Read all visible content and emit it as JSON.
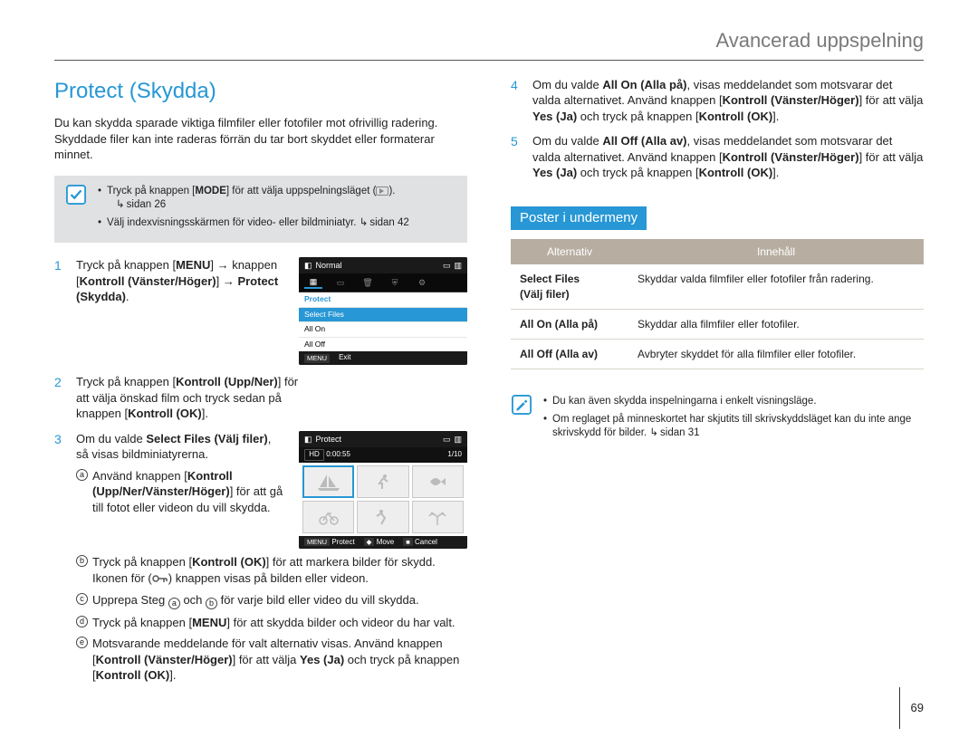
{
  "header": {
    "title": "Avancerad uppspelning"
  },
  "page_number": "69",
  "left": {
    "section_title": "Protect (Skydda)",
    "intro": "Du kan skydda sparade viktiga filmfiler eller fotofiler mot ofrivillig radering. Skyddade filer kan inte raderas förrän du tar bort skyddet eller formaterar minnet.",
    "note": {
      "items": [
        "Tryck på knappen [MODE] för att välja uppspelningsläget (   ).",
        "Välj indexvisningsskärmen för video- eller bildminiatyr."
      ],
      "refs": [
        "sidan 26",
        "sidan 42"
      ]
    },
    "steps": [
      {
        "n": 1,
        "parts": [
          "Tryck på knappen [",
          "MENU",
          "] → knappen [",
          "Kontroll (Vänster/Höger)",
          "] → ",
          "Protect (Skydda)",
          "."
        ]
      },
      {
        "n": 2,
        "parts": [
          "Tryck på knappen [",
          "Kontroll (Upp/Ner)",
          "] för att välja önskad film och tryck sedan på knappen [",
          "Kontroll (OK)",
          "]."
        ]
      },
      {
        "n": 3,
        "lead_parts": [
          "Om du valde ",
          "Select Files (Välj filer)",
          ", så visas bildminiatyrerna."
        ],
        "sub": [
          {
            "m": "a",
            "parts": [
              "Använd knappen [",
              "Kontroll (Upp/Ner/Vänster/Höger)",
              "] för att gå till fotot eller videon du vill skydda."
            ]
          },
          {
            "m": "b",
            "parts": [
              "Tryck på knappen [",
              "Kontroll (OK)",
              "] för att markera bilder för skydd. Ikonen för (   ) knappen visas på bilden eller videon."
            ]
          },
          {
            "m": "c",
            "parts_pre": "Upprepa Steg ",
            "marker1": "a",
            "mid": " och ",
            "marker2": "b",
            "parts_post": " för varje bild eller video du vill skydda."
          },
          {
            "m": "d",
            "parts": [
              "Tryck på knappen [",
              "MENU",
              "] för att skydda bilder och videor du har valt."
            ]
          },
          {
            "m": "e",
            "parts": [
              "Motsvarande meddelande för valt alternativ visas. Använd knappen [",
              "Kontroll (Vänster/Höger)",
              "] för att välja ",
              "Yes (Ja)",
              " och tryck på knappen [",
              "Kontroll (OK)",
              "]."
            ]
          }
        ]
      }
    ],
    "screen1": {
      "top_left_label": "Normal",
      "menu_head": "Protect",
      "items": [
        "Select Files",
        "All On",
        "All Off"
      ],
      "foot_btn": "MENU",
      "foot_label": "Exit"
    },
    "screen2": {
      "top_left_label": "Protect",
      "bar_left": "0:00:55",
      "bar_right": "1/10",
      "foot": [
        {
          "btn": "MENU",
          "label": "Protect"
        },
        {
          "btn": "◆",
          "label": "Move"
        },
        {
          "btn": "■",
          "label": "Cancel"
        }
      ]
    }
  },
  "right": {
    "steps": [
      {
        "n": 4,
        "parts": [
          "Om du valde ",
          "All On (Alla på)",
          ", visas meddelandet som motsvarar det valda alternativet. Använd knappen [",
          "Kontroll (Vänster/Höger)",
          "] för att välja ",
          "Yes (Ja)",
          " och tryck på knappen [",
          "Kontroll (OK)",
          "]."
        ]
      },
      {
        "n": 5,
        "parts": [
          "Om du valde ",
          "All Off (Alla av)",
          ", visas meddelandet som motsvarar det valda alternativet. Använd knappen [",
          "Kontroll (Vänster/Höger)",
          "] för att välja ",
          "Yes (Ja)",
          " och tryck på knappen [",
          "Kontroll (OK)",
          "]."
        ]
      }
    ],
    "submenu_title": "Poster i undermeny",
    "table": {
      "head": [
        "Alternativ",
        "Innehåll"
      ],
      "rows": [
        {
          "opt": "Select Files",
          "sub": "(Välj filer)",
          "desc": "Skyddar valda filmfiler eller fotofiler från radering."
        },
        {
          "opt": "All On (Alla på)",
          "desc": "Skyddar alla filmfiler eller fotofiler."
        },
        {
          "opt": "All Off (Alla av)",
          "desc": "Avbryter skyddet för alla filmfiler eller fotofiler."
        }
      ]
    },
    "note2": {
      "items": [
        "Du kan även skydda inspelningarna i enkelt visningsläge.",
        "Om reglaget på minneskortet har skjutits till skrivskyddsläget kan du inte ange skrivskydd för bilder."
      ],
      "ref": "sidan 31"
    }
  }
}
